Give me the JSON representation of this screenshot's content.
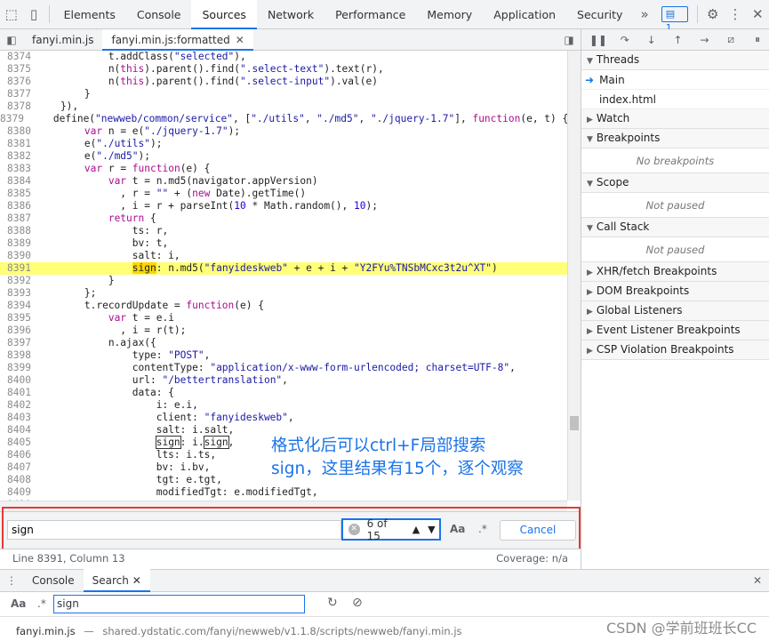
{
  "topbar": {
    "tabs": [
      "Elements",
      "Console",
      "Sources",
      "Network",
      "Performance",
      "Memory",
      "Application",
      "Security"
    ],
    "active_tab": "Sources",
    "more": "»",
    "issues_count": "1"
  },
  "files": {
    "tabs": [
      {
        "label": "fanyi.min.js",
        "active": false
      },
      {
        "label": "fanyi.min.js:formatted",
        "active": true
      }
    ]
  },
  "code": {
    "highlight_line": "8391",
    "lines": [
      {
        "n": "8374",
        "t": "            t.addClass(\"selected\"),"
      },
      {
        "n": "8375",
        "t": "            n(this).parent().find(\".select-text\").text(r),"
      },
      {
        "n": "8376",
        "t": "            n(this).parent().find(\".select-input\").val(e)"
      },
      {
        "n": "8377",
        "t": "        }"
      },
      {
        "n": "8378",
        "t": "    }),"
      },
      {
        "n": "8379",
        "t": "    define(\"newweb/common/service\", [\"./utils\", \"./md5\", \"./jquery-1.7\"], function(e, t) {"
      },
      {
        "n": "8380",
        "t": "        var n = e(\"./jquery-1.7\");"
      },
      {
        "n": "8381",
        "t": "        e(\"./utils\");"
      },
      {
        "n": "8382",
        "t": "        e(\"./md5\");"
      },
      {
        "n": "8383",
        "t": "        var r = function(e) {"
      },
      {
        "n": "8384",
        "t": "            var t = n.md5(navigator.appVersion)"
      },
      {
        "n": "8385",
        "t": "              , r = \"\" + (new Date).getTime()"
      },
      {
        "n": "8386",
        "t": "              , i = r + parseInt(10 * Math.random(), 10);"
      },
      {
        "n": "8387",
        "t": "            return {"
      },
      {
        "n": "8388",
        "t": "                ts: r,"
      },
      {
        "n": "8389",
        "t": "                bv: t,"
      },
      {
        "n": "8390",
        "t": "                salt: i,"
      },
      {
        "n": "8391",
        "t": "                sign: n.md5(\"fanyideskweb\" + e + i + \"Y2FYu%TNSbMCxc3t2u^XT\")"
      },
      {
        "n": "8392",
        "t": "            }"
      },
      {
        "n": "8393",
        "t": "        };"
      },
      {
        "n": "8394",
        "t": "        t.recordUpdate = function(e) {"
      },
      {
        "n": "8395",
        "t": "            var t = e.i"
      },
      {
        "n": "8396",
        "t": "              , i = r(t);"
      },
      {
        "n": "8397",
        "t": "            n.ajax({"
      },
      {
        "n": "8398",
        "t": "                type: \"POST\","
      },
      {
        "n": "8399",
        "t": "                contentType: \"application/x-www-form-urlencoded; charset=UTF-8\","
      },
      {
        "n": "8400",
        "t": "                url: \"/bettertranslation\","
      },
      {
        "n": "8401",
        "t": "                data: {"
      },
      {
        "n": "8402",
        "t": "                    i: e.i,"
      },
      {
        "n": "8403",
        "t": "                    client: \"fanyideskweb\","
      },
      {
        "n": "8404",
        "t": "                    salt: i.salt,"
      },
      {
        "n": "8405",
        "t": "                    sign: i.sign,"
      },
      {
        "n": "8406",
        "t": "                    lts: i.ts,"
      },
      {
        "n": "8407",
        "t": "                    bv: i.bv,"
      },
      {
        "n": "8408",
        "t": "                    tgt: e.tgt,"
      },
      {
        "n": "8409",
        "t": "                    modifiedTgt: e.modifiedTgt,"
      },
      {
        "n": "8410",
        "t": ""
      }
    ]
  },
  "annotation": {
    "line1": "格式化后可以ctrl+F局部搜索",
    "line2": "sign，这里结果有15个，逐个观察"
  },
  "search": {
    "query": "sign",
    "count": "6 of 15",
    "match_case": "Aa",
    "regex": ".*",
    "cancel": "Cancel"
  },
  "status": {
    "position": "Line 8391, Column 13",
    "coverage": "Coverage: n/a"
  },
  "debugger": {
    "sections": [
      {
        "label": "Threads",
        "open": true
      },
      {
        "label": "Watch",
        "open": false
      },
      {
        "label": "Breakpoints",
        "open": true
      },
      {
        "label": "Scope",
        "open": true
      },
      {
        "label": "Call Stack",
        "open": true
      },
      {
        "label": "XHR/fetch Breakpoints",
        "open": false
      },
      {
        "label": "DOM Breakpoints",
        "open": false
      },
      {
        "label": "Global Listeners",
        "open": false
      },
      {
        "label": "Event Listener Breakpoints",
        "open": false
      },
      {
        "label": "CSP Violation Breakpoints",
        "open": false
      }
    ],
    "threads": [
      "Main",
      "index.html"
    ],
    "no_breakpoints": "No breakpoints",
    "not_paused_scope": "Not paused",
    "not_paused_stack": "Not paused"
  },
  "drawer": {
    "tabs": [
      "Console",
      "Search"
    ],
    "active_tab": "Search",
    "aa": "Aa",
    "regex": ".*",
    "query": "sign",
    "result_file": "fanyi.min.js",
    "result_sep": "—",
    "result_path": "shared.ydstatic.com/fanyi/newweb/v1.1.8/scripts/newweb/fanyi.min.js"
  },
  "watermark": "CSDN @学前班班长CC"
}
